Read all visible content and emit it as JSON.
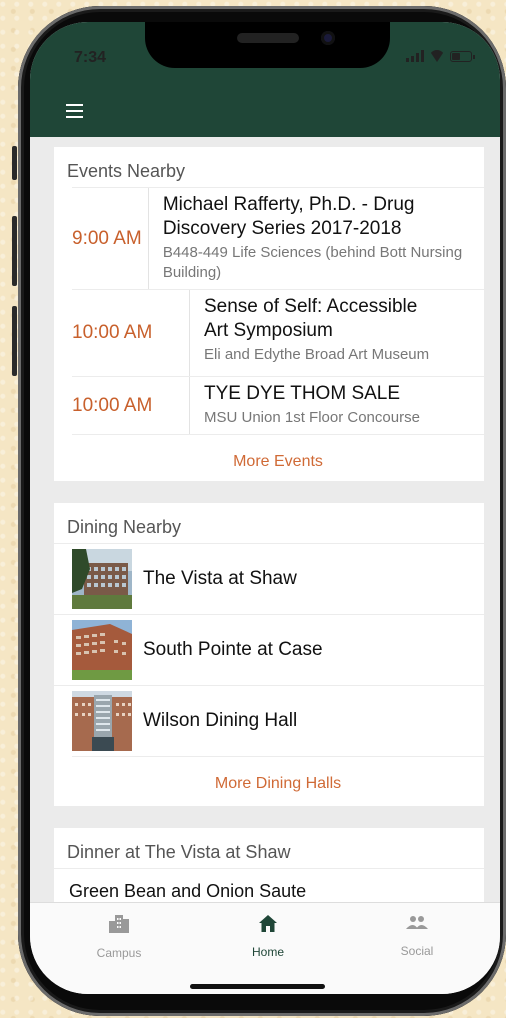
{
  "status_bar": {
    "time": "7:34"
  },
  "events": {
    "title": "Events Nearby",
    "items": [
      {
        "time": "9:00 AM",
        "title": "Michael Rafferty, Ph.D. - Drug Discovery Series 2017-2018",
        "location": "B448-449 Life Sciences  (behind Bott Nursing Building)"
      },
      {
        "time": "10:00 AM",
        "title": "Sense of Self: Accessible Art Symposium",
        "location": "Eli and Edythe Broad Art Museum"
      },
      {
        "time": "10:00 AM",
        "title": "TYE DYE THOM SALE",
        "location": "MSU Union 1st Floor Concourse"
      }
    ],
    "more_label": "More Events"
  },
  "dining": {
    "title": "Dining Nearby",
    "items": [
      {
        "name": "The Vista at Shaw"
      },
      {
        "name": "South Pointe at Case"
      },
      {
        "name": "Wilson Dining Hall"
      }
    ],
    "more_label": "More Dining Halls"
  },
  "dinner": {
    "title": "Dinner at The Vista at Shaw",
    "items": [
      {
        "name": "Green Bean and Onion Saute"
      }
    ]
  },
  "tabs": [
    {
      "label": "Campus",
      "icon": "building-icon",
      "active": false
    },
    {
      "label": "Home",
      "icon": "home-icon",
      "active": true
    },
    {
      "label": "Social",
      "icon": "people-icon",
      "active": false
    }
  ],
  "colors": {
    "header": "#1f4637",
    "accent": "#d06a36",
    "active_tab": "#1f4637",
    "inactive_tab": "#999999"
  }
}
